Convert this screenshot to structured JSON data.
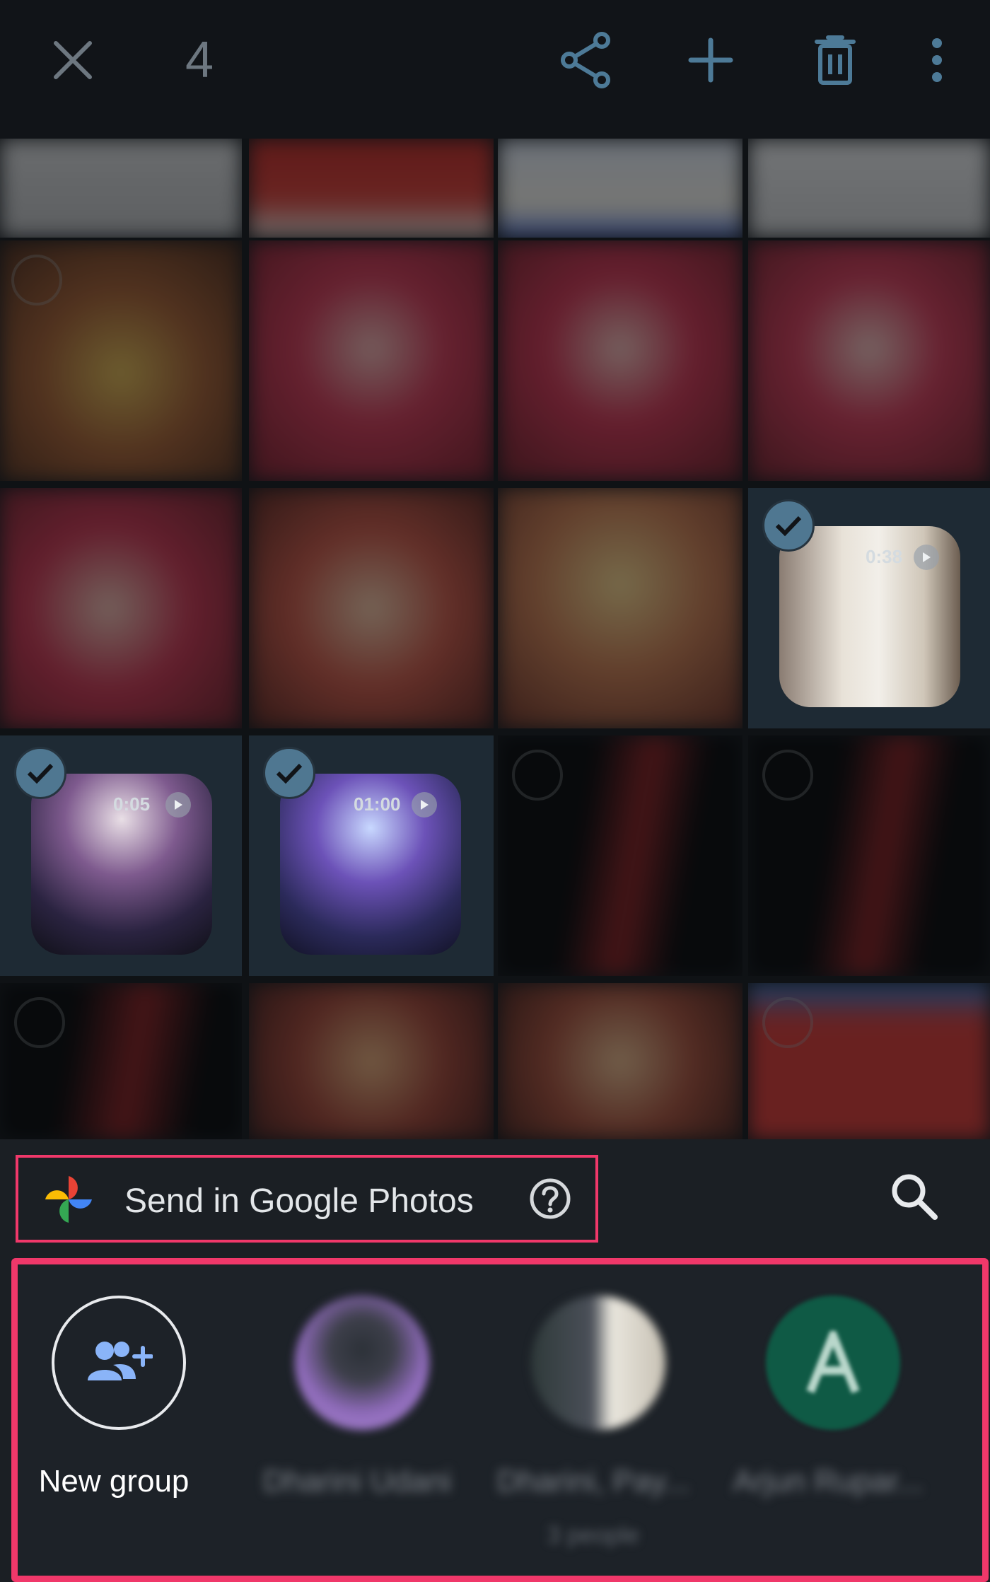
{
  "toolbar": {
    "selected_count": "4",
    "icons": [
      "close-icon",
      "share-icon",
      "add-icon",
      "delete-icon",
      "more-vert-icon"
    ]
  },
  "grid": {
    "selected_items": [
      {
        "duration": "0:38"
      },
      {
        "duration": "0:05"
      },
      {
        "duration": "01:00"
      }
    ]
  },
  "send_bar": {
    "label": "Send in Google Photos"
  },
  "contacts": [
    {
      "name": "New group",
      "sub": ""
    },
    {
      "name": "Dharini Udani",
      "sub": ""
    },
    {
      "name": "Dharini, Pay...",
      "sub": "3 people"
    },
    {
      "name": "Arjun Rupar...",
      "sub": ""
    }
  ],
  "colors": {
    "accent": "#4f7791",
    "highlight_border": "#f0386a",
    "sheet_bg": "#1b1f24"
  }
}
